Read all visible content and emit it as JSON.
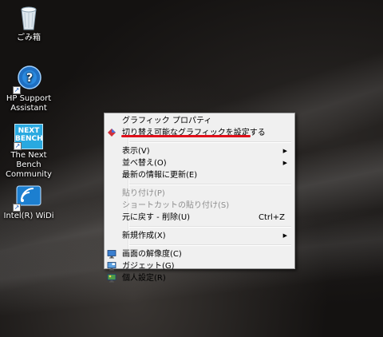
{
  "desktop": {
    "icons": [
      {
        "label": "ごみ箱",
        "icon": "recycle-bin-icon"
      },
      {
        "label": "HP Support Assistant",
        "icon": "hp-support-assistant-icon"
      },
      {
        "label": "The Next Bench Community",
        "icon": "next-bench-icon"
      },
      {
        "label": "Intel(R) WiDi",
        "icon": "intel-widi-icon"
      }
    ],
    "next_bench_logo_line1": "NEXT",
    "next_bench_logo_line2": "BENCH"
  },
  "context_menu": {
    "graphics_properties": "グラフィック プロパティ",
    "switchable_graphics": "切り替え可能なグラフィックを設定する",
    "view": "表示(V)",
    "sort_by": "並べ替え(O)",
    "refresh": "最新の情報に更新(E)",
    "paste": "貼り付け(P)",
    "paste_shortcut": "ショートカットの貼り付け(S)",
    "undo_delete": "元に戻す - 削除(U)",
    "undo_delete_key": "Ctrl+Z",
    "new": "新規作成(X)",
    "screen_resolution": "画面の解像度(C)",
    "gadgets": "ガジェット(G)",
    "personalize": "個人設定(R)"
  },
  "colors": {
    "highlight_underline": "#e0101a",
    "menu_background": "#f0f0f0"
  }
}
